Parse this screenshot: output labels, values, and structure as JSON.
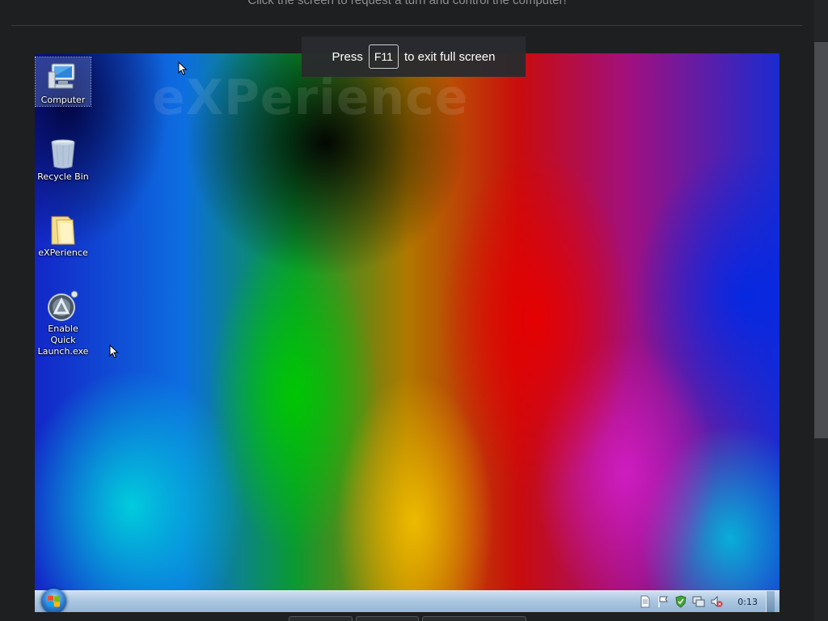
{
  "page": {
    "instruction": "Click the screen to request a turn and control the computer!"
  },
  "fullscreen_notice": {
    "prefix": "Press",
    "key": "F11",
    "suffix": "to exit full screen"
  },
  "desktop": {
    "watermark": "eXPerience",
    "icons": [
      {
        "label": "Computer",
        "icon": "computer-icon"
      },
      {
        "label": "Recycle Bin",
        "icon": "recycle-bin-icon"
      },
      {
        "label": "eXPerience",
        "icon": "folder-icon"
      },
      {
        "label": "Enable Quick Launch.exe",
        "icon": "quick-launch-icon"
      }
    ]
  },
  "taskbar": {
    "clock": "0:13",
    "tray_icons": [
      "document-icon",
      "flag-icon",
      "security-icon",
      "network-icon",
      "speaker-muted-icon"
    ]
  },
  "colors": {
    "page_bg": "#1e1f21",
    "taskbar": "#a9c5e0",
    "toast_bg": "#2a2b2e"
  }
}
